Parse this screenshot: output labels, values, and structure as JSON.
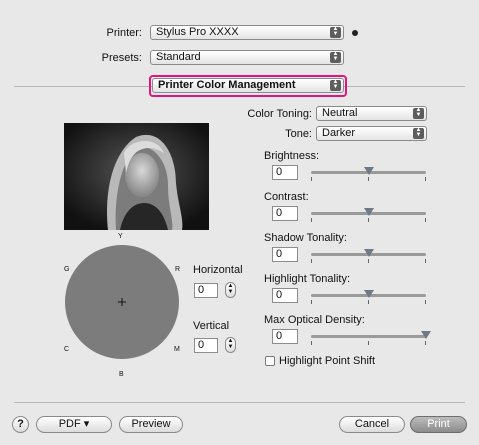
{
  "printer": {
    "label": "Printer:",
    "value": "Stylus Pro XXXX"
  },
  "presets": {
    "label": "Presets:",
    "value": "Standard"
  },
  "panel": {
    "value": "Printer Color Management"
  },
  "color_toning": {
    "label": "Color Toning:",
    "value": "Neutral"
  },
  "tone": {
    "label": "Tone:",
    "value": "Darker"
  },
  "sliders": [
    {
      "label": "Brightness:",
      "value": "0",
      "level": 0.5
    },
    {
      "label": "Contrast:",
      "value": "0",
      "level": 0.5
    },
    {
      "label": "Shadow Tonality:",
      "value": "0",
      "level": 0.5
    },
    {
      "label": "Highlight Tonality:",
      "value": "0",
      "level": 0.5
    },
    {
      "label": "Max Optical Density:",
      "value": "0",
      "level": 1.0
    }
  ],
  "color_wheel": {
    "labels": {
      "y": "Y",
      "r": "R",
      "m": "M",
      "b": "B",
      "c": "C",
      "g": "G"
    }
  },
  "horizontal": {
    "label": "Horizontal",
    "value": "0"
  },
  "vertical": {
    "label": "Vertical",
    "value": "0"
  },
  "highlight_point_shift": {
    "label": "Highlight Point Shift",
    "checked": false
  },
  "buttons": {
    "help": "?",
    "pdf": "PDF ▾",
    "preview": "Preview",
    "cancel": "Cancel",
    "print": "Print"
  },
  "colors": {
    "accent_highlight": "#e0157d",
    "wheel": "#7c7c7c"
  }
}
